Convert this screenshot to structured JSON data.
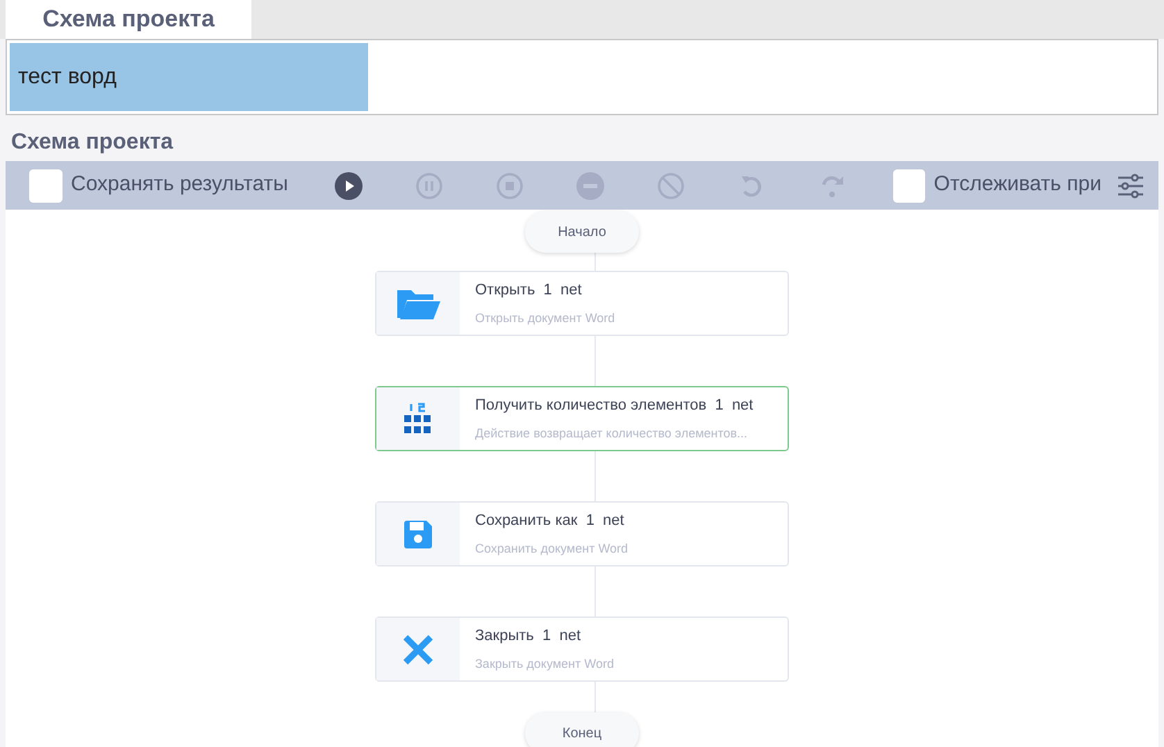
{
  "tabs": [
    {
      "label": "Схема проекта",
      "selected": true
    }
  ],
  "projects": [
    {
      "label": "тест ворд",
      "selected": true
    }
  ],
  "section_title": "Схема проекта",
  "toolbar": {
    "save_results": {
      "label": "Сохранять результаты",
      "checked": false
    },
    "buttons": [
      {
        "kind": "play",
        "disabled": false
      },
      {
        "kind": "pause",
        "disabled": true
      },
      {
        "kind": "stop",
        "disabled": true
      },
      {
        "kind": "minus",
        "disabled": true
      },
      {
        "kind": "cancel",
        "disabled": true
      },
      {
        "kind": "undo",
        "disabled": true
      },
      {
        "kind": "redo",
        "disabled": true
      }
    ],
    "track": {
      "label": "Отслеживать при",
      "checked": false
    }
  },
  "flow": {
    "start": "Начало",
    "end": "Конец",
    "steps": [
      {
        "kind": "folder",
        "title": "Открыть  1  net",
        "description": "Открыть документ Word",
        "selected": false
      },
      {
        "kind": "grid",
        "title": "Получить количество элементов  1  net",
        "description": "Действие возвращает количество элементов...",
        "selected": true
      },
      {
        "kind": "save",
        "title": "Сохранить как  1  net",
        "description": "Сохранить документ Word",
        "selected": false
      },
      {
        "kind": "close",
        "title": "Закрыть  1  net",
        "description": "Закрыть документ Word",
        "selected": false
      }
    ]
  }
}
